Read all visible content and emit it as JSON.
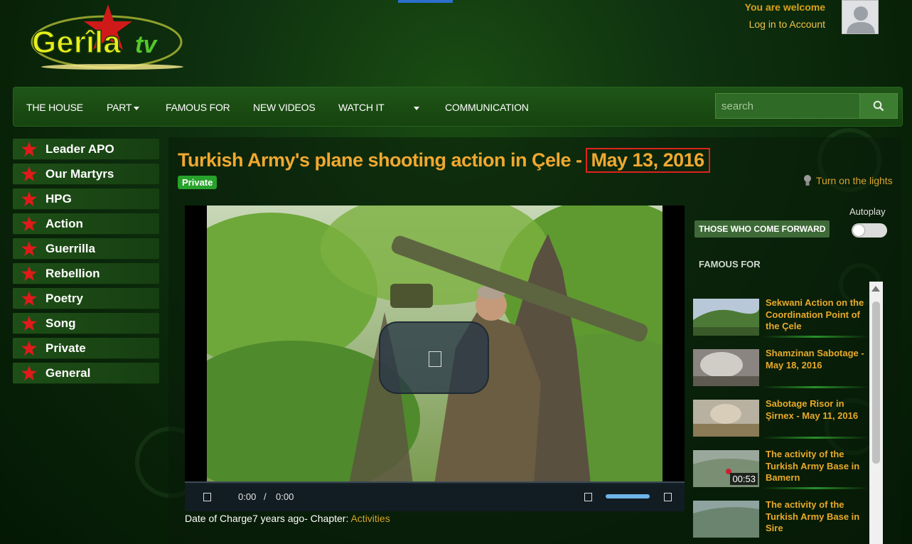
{
  "header": {
    "logo_text": "Gerîlatv",
    "welcome": "You are welcome",
    "login": "Log in to Account"
  },
  "nav": {
    "items": [
      "THE HOUSE",
      "PART",
      "FAMOUS FOR",
      "NEW VIDEOS",
      "WATCH IT",
      "",
      "COMMUNICATION"
    ],
    "search_placeholder": "search"
  },
  "sidebar": {
    "items": [
      "Leader APO",
      "Our Martyrs",
      "HPG",
      "Action",
      "Guerrilla",
      "Rebellion",
      "Poetry",
      "Song",
      "Private",
      "General"
    ]
  },
  "video": {
    "title": "Turkish Army's plane shooting action in Çele - ",
    "title_date": "May 13, 2016",
    "badge": "Private",
    "lights": "Turn on the lights",
    "time_current": "0:00",
    "time_sep": "/",
    "time_total": "0:00",
    "meta_prefix": "Date of Charge7 years ago- Chapter: ",
    "meta_link": "Activities"
  },
  "related": {
    "forward_label": "THOSE WHO COME FORWARD",
    "autoplay": "Autoplay",
    "famous_for": "FAMOUS FOR",
    "items": [
      {
        "title": "Sekwani Action on the Coordination Point of the Çele",
        "duration": ""
      },
      {
        "title": "Shamzinan Sabotage - May 18, 2016",
        "duration": ""
      },
      {
        "title": "Sabotage Risor in Şirnex - May 11, 2016",
        "duration": ""
      },
      {
        "title": "The activity of the Turkish Army Base in Bamern",
        "duration": "00:53"
      },
      {
        "title": "The activity of the Turkish Army Base in Sire",
        "duration": ""
      }
    ]
  },
  "colors": {
    "accent": "#f0a830",
    "link": "#d6a326",
    "highlight": "#e0221e",
    "badge": "#27a22a"
  }
}
